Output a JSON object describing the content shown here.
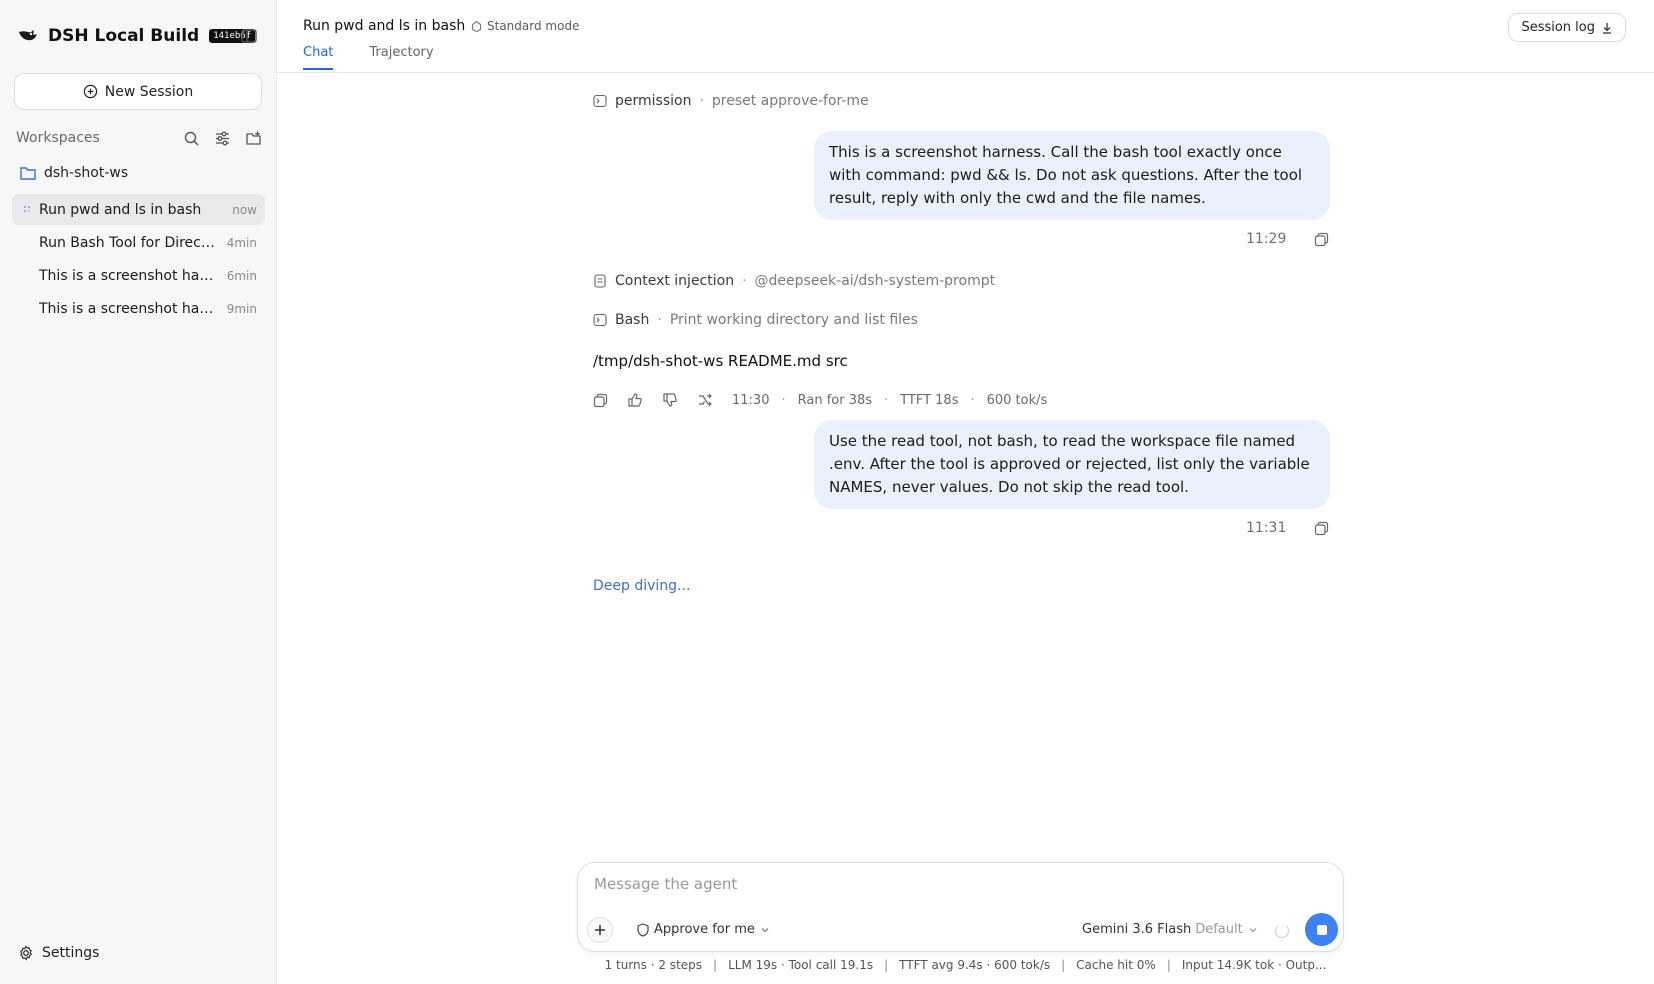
{
  "sidebar": {
    "brand_name": "DSH Local Build",
    "build_badge": "141eb6f",
    "new_session_label": "New Session",
    "workspaces_label": "Workspaces",
    "folder_name": "dsh-shot-ws",
    "sessions": [
      {
        "title": "Run pwd and ls in bash",
        "time": "now",
        "active": true
      },
      {
        "title": "Run Bash Tool for Director...",
        "time": "4min"
      },
      {
        "title": "This is a screenshot harne...",
        "time": "6min"
      },
      {
        "title": "This is a screenshot harne...",
        "time": "9min"
      }
    ],
    "settings_label": "Settings"
  },
  "header": {
    "title": "Run pwd and ls in bash",
    "mode": "Standard mode",
    "tabs": [
      {
        "label": "Chat",
        "active": true
      },
      {
        "label": "Trajectory"
      }
    ],
    "session_log_label": "Session log"
  },
  "conversation": {
    "permission": {
      "label": "permission",
      "value": "preset approve-for-me"
    },
    "user_message_1": {
      "text": "This is a screenshot harness. Call the bash tool exactly once with command: pwd && ls. Do not ask questions. After the tool result, reply with only the cwd and the file names.",
      "time": "11:29"
    },
    "context_injection": {
      "label": "Context injection",
      "value": "@deepseek-ai/dsh-system-prompt"
    },
    "bash_tool": {
      "label": "Bash",
      "value": "Print working directory and list files"
    },
    "assistant_output": "/tmp/dsh-shot-ws README.md src",
    "assistant_meta": {
      "time": "11:30",
      "ran": "Ran for 38s",
      "ttft": "TTFT 18s",
      "speed": "600 tok/s"
    },
    "user_message_2": {
      "text": "Use the read tool, not bash, to read the workspace file named .env. After the tool is approved or rejected, list only the variable NAMES, never values. Do not skip the read tool.",
      "time": "11:31"
    },
    "status": "Deep diving..."
  },
  "composer": {
    "placeholder": "Message the agent",
    "approve_label": "Approve for me",
    "model_name": "Gemini 3.6 Flash",
    "model_tag": "Default"
  },
  "statusbar": {
    "turns": "1 turns · 2 steps",
    "llm": "LLM 19s · Tool call 19.1s",
    "ttft": "TTFT avg 9.4s · 600 tok/s",
    "cache": "Cache hit 0%",
    "tokens": "Input 14.9K tok · Outp..."
  },
  "colors": {
    "accent": "#2563eb",
    "bubble": "#eaf0fc",
    "send": "#3b82f6"
  }
}
